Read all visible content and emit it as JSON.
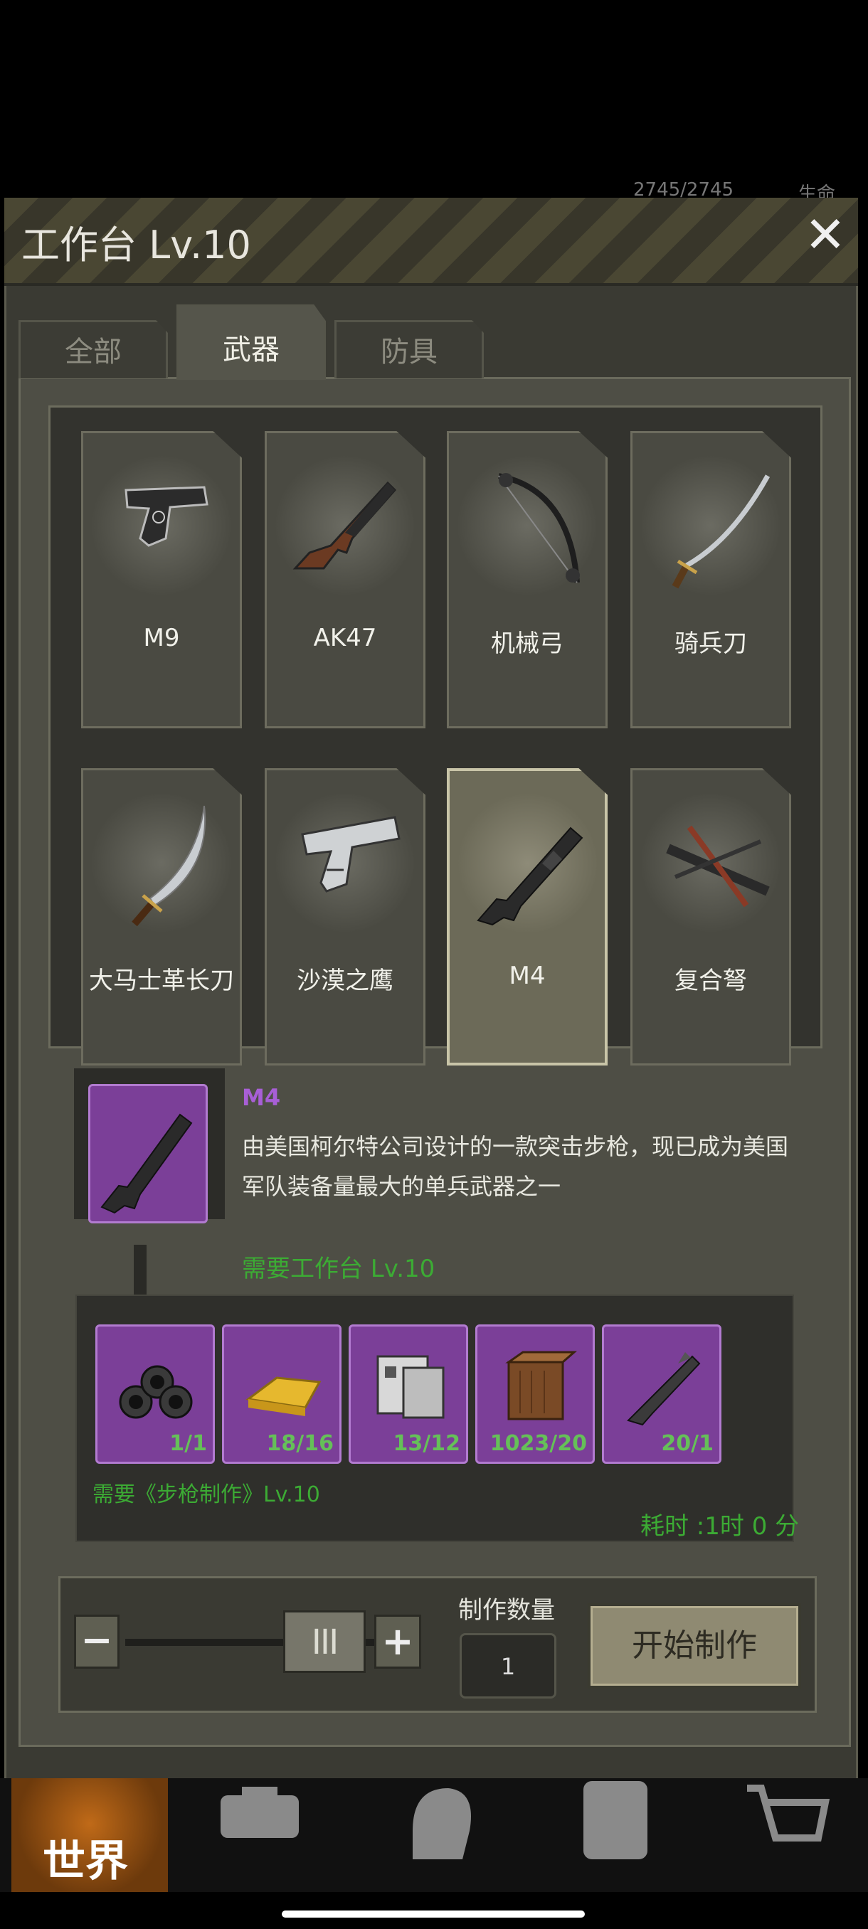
{
  "hud": {
    "hp": "2745/2745",
    "hp_label": "生命"
  },
  "window": {
    "title": "工作台 Lv.10",
    "close": "✕"
  },
  "tabs": [
    {
      "label": "全部",
      "active": false
    },
    {
      "label": "武器",
      "active": true
    },
    {
      "label": "防具",
      "active": false
    }
  ],
  "items": [
    {
      "name": "M9",
      "icon": "pistol-icon"
    },
    {
      "name": "AK47",
      "icon": "rifle-icon"
    },
    {
      "name": "机械弓",
      "icon": "bow-icon"
    },
    {
      "name": "骑兵刀",
      "icon": "saber-icon"
    },
    {
      "name": "大马士革长刀",
      "icon": "scimitar-icon"
    },
    {
      "name": "沙漠之鹰",
      "icon": "pistol-icon"
    },
    {
      "name": "M4",
      "icon": "rifle-icon",
      "selected": true
    },
    {
      "name": "复合弩",
      "icon": "crossbow-icon"
    }
  ],
  "detail": {
    "name": "M4",
    "description": "由美国柯尔特公司设计的一款突击步枪，现已成为美国军队装备量最大的单兵武器之一",
    "requirement": "需要工作台 Lv.10",
    "skill_requirement": "需要《步枪制作》Lv.10",
    "time": "耗时 :1时 0 分",
    "materials": [
      {
        "icon": "pipes-icon",
        "count": "1/1"
      },
      {
        "icon": "gold-bar-icon",
        "count": "18/16"
      },
      {
        "icon": "machine-parts-icon",
        "count": "13/12"
      },
      {
        "icon": "wood-icon",
        "count": "1023/20"
      },
      {
        "icon": "rifle-barrel-icon",
        "count": "20/1"
      }
    ]
  },
  "controls": {
    "minus": "−",
    "plus": "+",
    "slider_handle": "III",
    "quantity_label": "制作数量",
    "quantity": "1",
    "start_label": "开始制作"
  },
  "bottom_nav": {
    "world": "世界"
  },
  "colors": {
    "accent_purple": "#7b3f98",
    "requirement_green": "#3cab34"
  }
}
